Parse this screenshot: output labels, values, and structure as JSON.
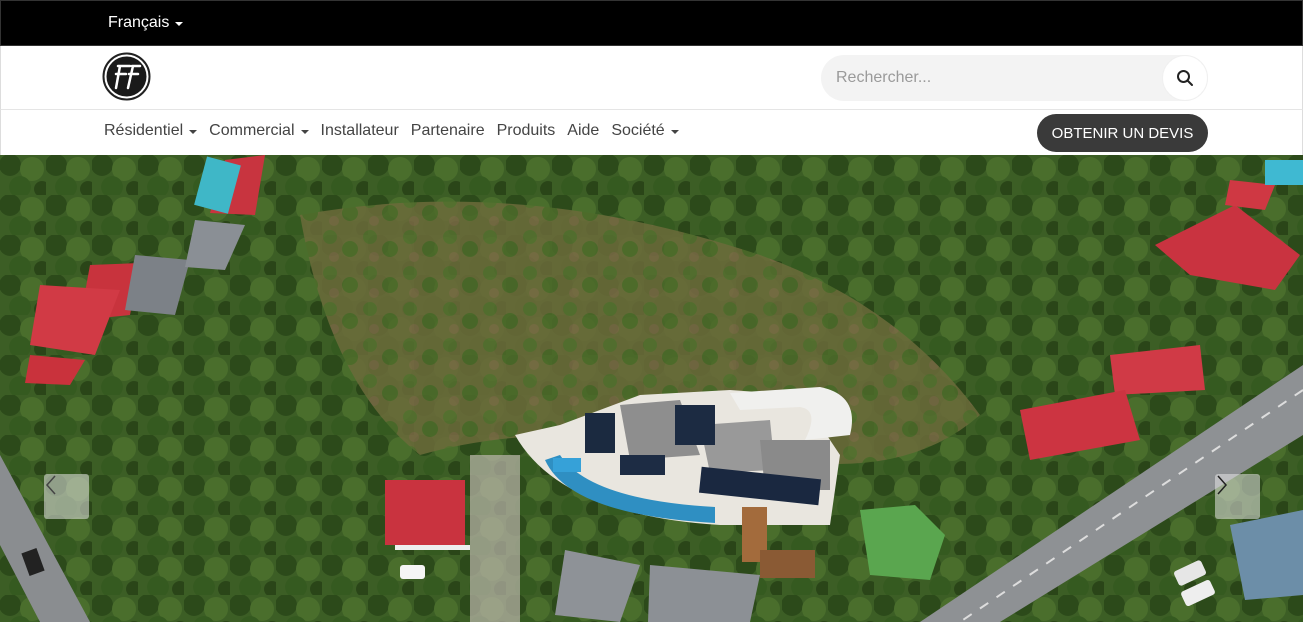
{
  "topbar": {
    "language": "Français"
  },
  "header": {
    "search": {
      "placeholder": "Rechercher...",
      "value": ""
    }
  },
  "nav": {
    "items": [
      {
        "label": "Résidentiel",
        "dropdown": true
      },
      {
        "label": "Commercial",
        "dropdown": true
      },
      {
        "label": "Installateur",
        "dropdown": false
      },
      {
        "label": "Partenaire",
        "dropdown": false
      },
      {
        "label": "Produits",
        "dropdown": false
      },
      {
        "label": "Aide",
        "dropdown": false
      },
      {
        "label": "Société",
        "dropdown": true
      }
    ],
    "cta_label": "OBTENIR UN DEVIS"
  },
  "hero": {
    "image": "aerial-villa-solar-panels",
    "controls": {
      "prev_icon": "chevron-left-icon",
      "next_icon": "chevron-right-icon"
    }
  },
  "colors": {
    "topbar": "#000000",
    "cta": "#3a3a3a",
    "search_bg": "#f3f3f3"
  }
}
